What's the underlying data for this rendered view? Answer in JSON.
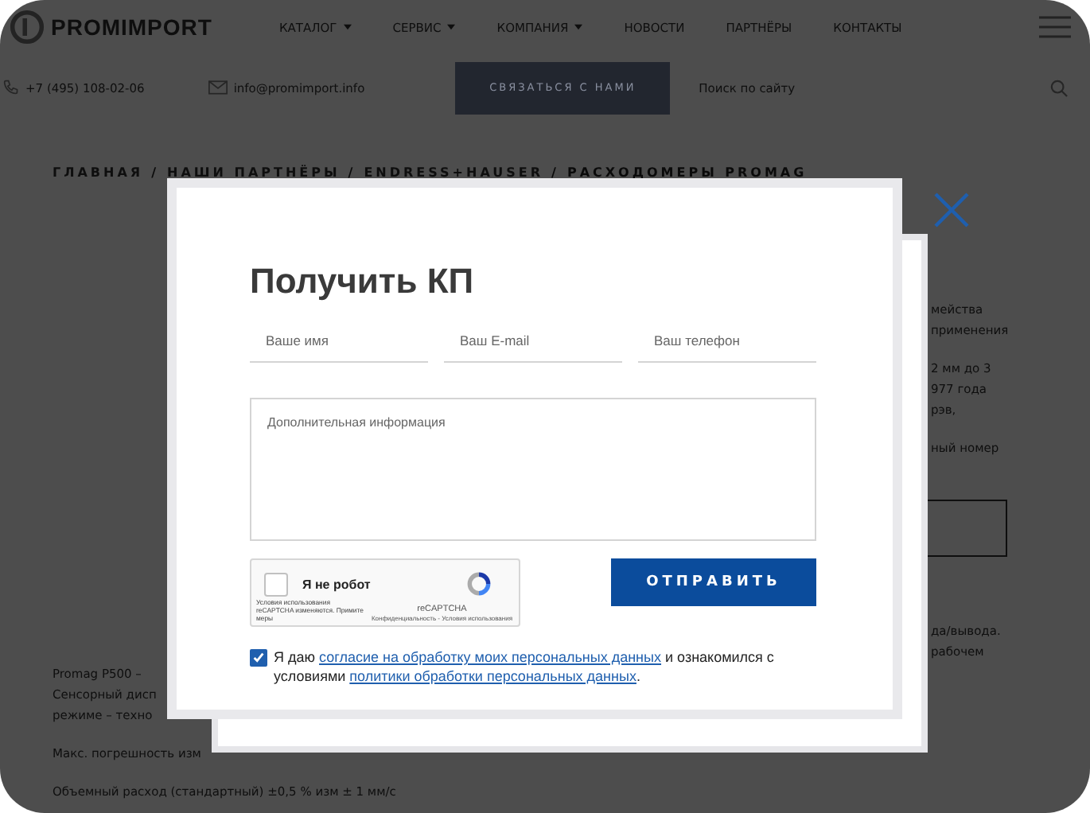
{
  "header": {
    "logo": "PROMIMPORT",
    "nav": [
      {
        "label": "КАТАЛОГ",
        "dropdown": true
      },
      {
        "label": "СЕРВИС",
        "dropdown": true
      },
      {
        "label": "КОМПАНИЯ",
        "dropdown": true
      },
      {
        "label": "НОВОСТИ",
        "dropdown": false
      },
      {
        "label": "ПАРТНЁРЫ",
        "dropdown": false
      },
      {
        "label": "КОНТАКТЫ",
        "dropdown": false
      }
    ]
  },
  "contacts": {
    "phone": "+7 (495) 108-02-06",
    "email": "info@promimport.info",
    "button": "СВЯЗАТЬСЯ С НАМИ",
    "search_placeholder": "Поиск по сайту"
  },
  "breadcrumb": {
    "separator": "/",
    "items": [
      "ГЛАВНАЯ",
      "НАШИ ПАРТНЁРЫ",
      "ENDRESS+HAUSER",
      "РАСХОДОМЕРЫ PROMAG"
    ]
  },
  "content": {
    "left_paragraphs": [
      [
        "Promag P500 –",
        "Сенсорный дисп",
        "режиме – техно"
      ],
      [
        "Макс. погрешность изм"
      ],
      [
        "Объемный расход (стандартный)  ±0,5 % изм ± 1 мм/с"
      ]
    ],
    "right_paragraphs": [
      [
        "мейства",
        "применения"
      ],
      [
        "2 мм до 3",
        "977 года",
        "рэв,"
      ],
      [
        "ный номер"
      ]
    ],
    "right_paragraphs_after_box": [
      [
        "да/вывода.",
        "рабочем"
      ]
    ]
  },
  "modal": {
    "title": "Получить КП",
    "fields": [
      {
        "placeholder": "Ваше имя"
      },
      {
        "placeholder": "Ваш E-mail"
      },
      {
        "placeholder": "Ваш телефон"
      }
    ],
    "textarea": {
      "placeholder": "Дополнительная информация"
    },
    "captcha": {
      "checked": false,
      "label": "Я не робот",
      "brand": "reCAPTCHA",
      "notice": "Условия использования reCAPTCHA изменяются. Примите меры",
      "links": "Конфиденциальность - Условия использования"
    },
    "submit": "ОТПРАВИТЬ",
    "consent": {
      "checked": true,
      "parts": [
        {
          "text": "Я даю ",
          "link": false
        },
        {
          "text": "согласие на обработку моих персональных данных",
          "link": true
        },
        {
          "text": " и ознакомился с условиями ",
          "link": false
        },
        {
          "text": "политики обработки персональных данных",
          "link": true
        },
        {
          "text": ".",
          "link": false
        }
      ]
    }
  }
}
